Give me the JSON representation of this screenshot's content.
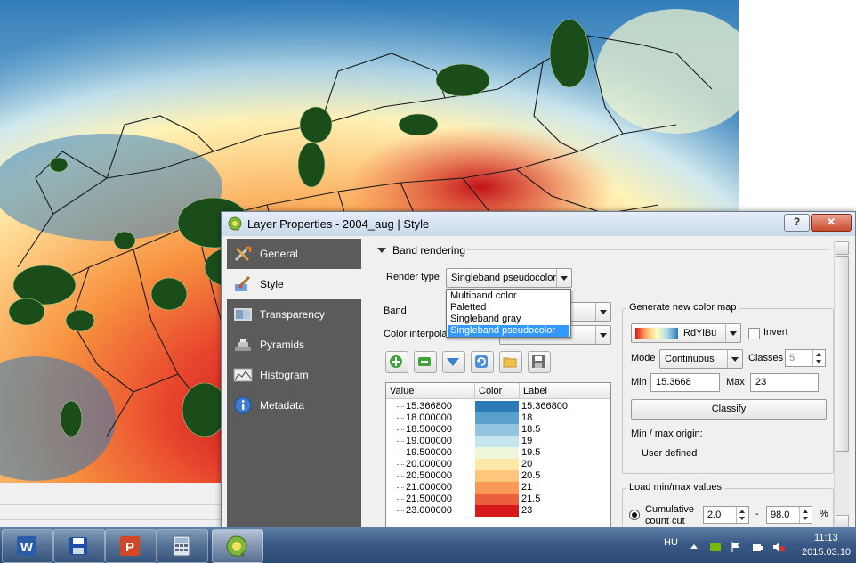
{
  "colors": {
    "map_hot": "#d7191c",
    "map_warm": "#fdae61",
    "map_mid": "#ffffbf",
    "map_cool": "#abd9e9",
    "map_cold": "#2c7bb6",
    "points": "#1b4d1b",
    "sidebar_bg": "#5b5b5b",
    "selection": "#3399ff"
  },
  "dialog": {
    "title": "Layer Properties - 2004_aug | Style",
    "help_label": "?",
    "close_label": "✕"
  },
  "sidebar": {
    "items": [
      {
        "label": "General",
        "icon": "wrench-screwdriver-icon"
      },
      {
        "label": "Style",
        "icon": "brush-icon"
      },
      {
        "label": "Transparency",
        "icon": "transparency-icon"
      },
      {
        "label": "Pyramids",
        "icon": "pyramid-icon"
      },
      {
        "label": "Histogram",
        "icon": "histogram-icon"
      },
      {
        "label": "Metadata",
        "icon": "info-icon"
      }
    ],
    "active": "Style"
  },
  "band_rendering": {
    "section_title": "Band rendering",
    "render_type_label": "Render type",
    "render_type_value": "Singleband pseudocolor",
    "render_type_options": [
      "Multiband color",
      "Paletted",
      "Singleband gray",
      "Singleband pseudocolor"
    ],
    "band_label": "Band",
    "color_interp_label": "Color interpola"
  },
  "table": {
    "headers": [
      "Value",
      "Color",
      "Label"
    ],
    "rows": [
      {
        "value": "15.366800",
        "color": "#2c7bb6",
        "label": "15.366800"
      },
      {
        "value": "18.000000",
        "color": "#5aa0cc",
        "label": "18"
      },
      {
        "value": "18.500000",
        "color": "#94c4df",
        "label": "18.5"
      },
      {
        "value": "19.000000",
        "color": "#c7e5ee",
        "label": "19"
      },
      {
        "value": "19.500000",
        "color": "#eef7d9",
        "label": "19.5"
      },
      {
        "value": "20.000000",
        "color": "#fee9a8",
        "label": "20"
      },
      {
        "value": "20.500000",
        "color": "#fdc67b",
        "label": "20.5"
      },
      {
        "value": "21.000000",
        "color": "#f89a55",
        "label": "21"
      },
      {
        "value": "21.500000",
        "color": "#ea5f3c",
        "label": "21.5"
      },
      {
        "value": "23.000000",
        "color": "#d7191c",
        "label": "23"
      }
    ]
  },
  "color_map": {
    "group_title": "Generate new color map",
    "ramp_name": "RdYlBu",
    "invert_label": "Invert",
    "mode_label": "Mode",
    "mode_value": "Continuous",
    "classes_label": "Classes",
    "classes_value": "5",
    "min_label": "Min",
    "min_value": "15.3668",
    "max_label": "Max",
    "max_value": "23",
    "classify_label": "Classify",
    "origin_label": "Min / max origin:",
    "origin_value": "User defined"
  },
  "minmax": {
    "group_title": "Load min/max values",
    "cumulative_label_1": "Cumulative",
    "cumulative_label_2": "count cut",
    "low_value": "2.0",
    "dash": "-",
    "high_value": "98.0",
    "percent": "%"
  },
  "taskbar": {
    "apps": [
      "word-icon",
      "save-icon",
      "powerpoint-icon",
      "calculator-icon",
      "qgis-icon"
    ],
    "language": "HU",
    "time": "11:13",
    "date": "2015.03.10."
  }
}
